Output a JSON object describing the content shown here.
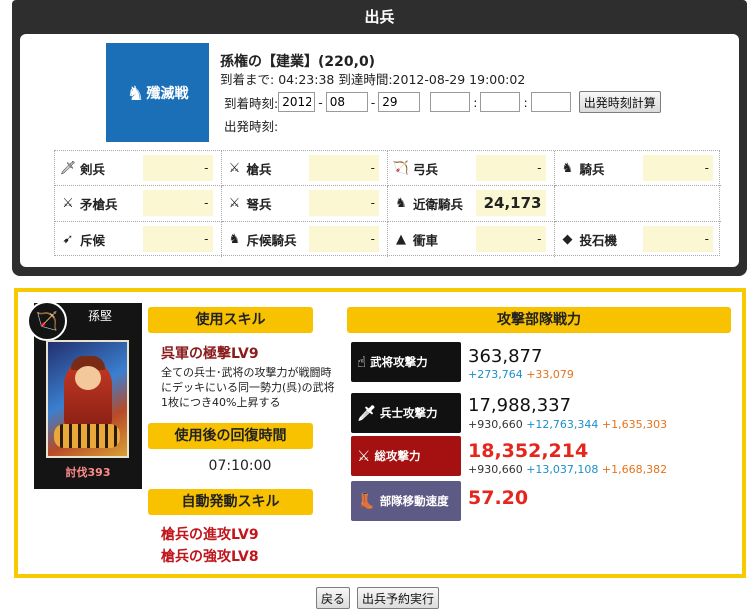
{
  "header": {
    "title": "出兵"
  },
  "battle": {
    "logo_text": "殲滅戦"
  },
  "destination": {
    "title": "孫権の【建業】(220,0)",
    "arrive_label": "到着まで:",
    "arrive_duration": "04:23:38",
    "arrive_time_label": "到達時間:",
    "arrive_time": "2012-08-29 19:00:02"
  },
  "arrival_form": {
    "label": "到着時刻:",
    "year": "2012",
    "month": "08",
    "day": "29",
    "hour": "",
    "minute": "",
    "second": "",
    "sep_dash": "-",
    "sep_colon": ":",
    "calc_button": "出発時刻計算",
    "depart_label": "出発時刻:"
  },
  "troops": [
    {
      "icon": "sword-soldier-icon",
      "name": "剣兵",
      "value": "-"
    },
    {
      "icon": "spear-soldier-icon",
      "name": "槍兵",
      "value": "-"
    },
    {
      "icon": "archer-icon",
      "name": "弓兵",
      "value": "-"
    },
    {
      "icon": "cavalry-icon",
      "name": "騎兵",
      "value": "-"
    },
    {
      "icon": "pike-soldier-icon",
      "name": "矛槍兵",
      "value": "-"
    },
    {
      "icon": "crossbow-soldier-icon",
      "name": "弩兵",
      "value": "-"
    },
    {
      "icon": "guard-cavalry-icon",
      "name": "近衛騎兵",
      "value": "24,173"
    },
    {
      "icon": "",
      "name": "",
      "value": ""
    },
    {
      "icon": "scout-icon",
      "name": "斥候",
      "value": "-"
    },
    {
      "icon": "scout-cavalry-icon",
      "name": "斥候騎兵",
      "value": "-"
    },
    {
      "icon": "battering-ram-icon",
      "name": "衝車",
      "value": "-"
    },
    {
      "icon": "catapult-icon",
      "name": "投石機",
      "value": "-"
    }
  ],
  "general": {
    "name": "孫堅",
    "kills": "討伐393"
  },
  "skills": {
    "use_label": "使用スキル",
    "skill_name": "呉軍の極撃LV9",
    "skill_desc": "全ての兵士･武将の攻撃力が戦闘時にデッキにいる同一勢力(呉)の武将1枚につき40%上昇する",
    "recovery_label": "使用後の回復時間",
    "recovery_time": "07:10:00",
    "auto_label": "自動発動スキル",
    "auto_skills": [
      "槍兵の進攻LV9",
      "槍兵の強攻LV8"
    ]
  },
  "power": {
    "label": "攻撃部隊戦力",
    "general_attack": {
      "label": "武将攻撃力",
      "value": "363,877",
      "bonus_blue": "+273,764",
      "bonus_orange": "+33,079"
    },
    "soldier_attack": {
      "label": "兵士攻撃力",
      "value": "17,988,337",
      "base": "+930,660",
      "bonus_blue": "+12,763,344",
      "bonus_orange": "+1,635,303"
    },
    "total_attack": {
      "label": "総攻撃力",
      "value": "18,352,214",
      "base": "+930,660",
      "bonus_blue": "+13,037,108",
      "bonus_orange": "+1,668,382"
    },
    "move_speed": {
      "label": "部隊移動速度",
      "value": "57.20"
    }
  },
  "footer": {
    "back_button": "戻る",
    "execute_button": "出兵予約実行"
  },
  "colors": {
    "accent_yellow": "#f8c200",
    "battle_blue": "#1a6fb6",
    "total_red": "#e5261d"
  }
}
